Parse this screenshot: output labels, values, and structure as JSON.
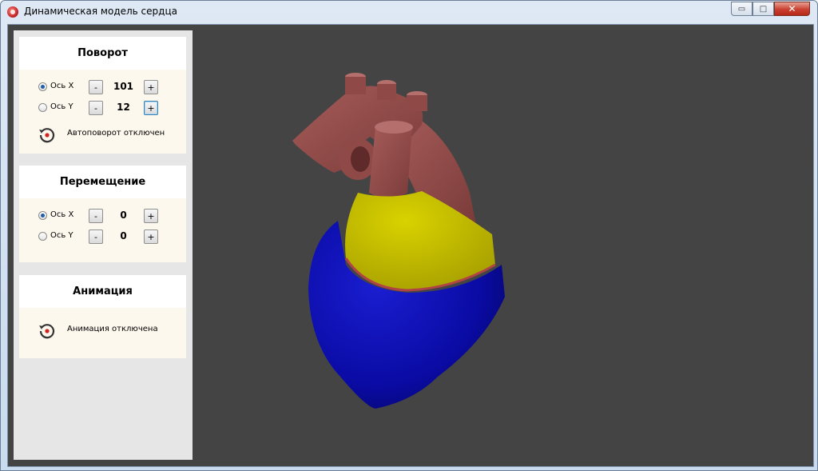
{
  "window": {
    "title": "Динамическая модель сердца",
    "min_glyph": "▭",
    "max_glyph": "□",
    "close_glyph": "✕"
  },
  "rotation": {
    "title": "Поворот",
    "x": {
      "label": "Ось X",
      "value": "101",
      "selected": true
    },
    "y": {
      "label": "Ось Y",
      "value": "12",
      "selected": false
    },
    "minus": "-",
    "plus": "+",
    "status": "Автоповорот отключен"
  },
  "movement": {
    "title": "Перемещение",
    "x": {
      "label": "Ось X",
      "value": "0",
      "selected": true
    },
    "y": {
      "label": "Ось Y",
      "value": "0",
      "selected": false
    },
    "minus": "-",
    "plus": "+"
  },
  "animation": {
    "title": "Анимация",
    "status": "Анимация отключена"
  },
  "colors": {
    "background": "#444444",
    "vessels": "#8f4a48",
    "atrium": "#c5be00",
    "ventricle": "#0a0ba4",
    "sidebar": "#e6e6e6",
    "panel": "#fdf8ed"
  }
}
